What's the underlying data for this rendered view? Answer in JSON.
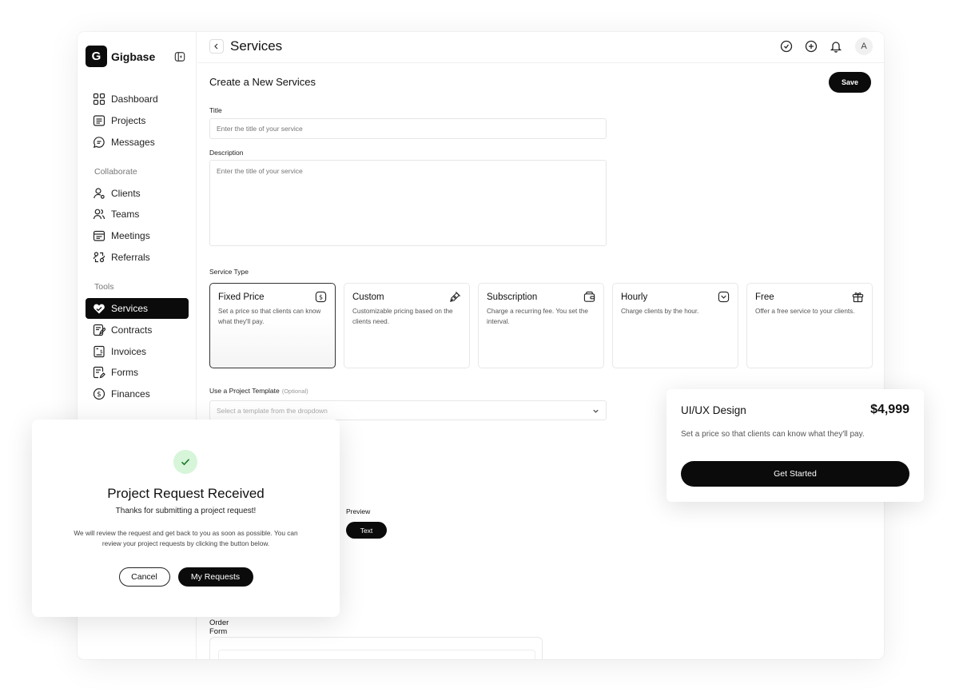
{
  "brand": {
    "logo_letter": "G",
    "name": "Gigbase"
  },
  "sidebar": {
    "main": [
      {
        "label": "Dashboard",
        "icon": "grid-icon"
      },
      {
        "label": "Projects",
        "icon": "list-icon"
      },
      {
        "label": "Messages",
        "icon": "chat-icon"
      }
    ],
    "collaborate_heading": "Collaborate",
    "collaborate": [
      {
        "label": "Clients",
        "icon": "user-icon"
      },
      {
        "label": "Teams",
        "icon": "users-icon"
      },
      {
        "label": "Meetings",
        "icon": "calendar-icon"
      },
      {
        "label": "Referrals",
        "icon": "referral-icon"
      }
    ],
    "tools_heading": "Tools",
    "tools": [
      {
        "label": "Services",
        "icon": "heart-hand-icon",
        "active": true
      },
      {
        "label": "Contracts",
        "icon": "contract-icon"
      },
      {
        "label": "Invoices",
        "icon": "invoice-icon"
      },
      {
        "label": "Forms",
        "icon": "form-icon"
      },
      {
        "label": "Finances",
        "icon": "dollar-icon"
      }
    ]
  },
  "header": {
    "title": "Services",
    "avatar": "A"
  },
  "form": {
    "heading": "Create a New Services",
    "save_label": "Save",
    "title_label": "Title",
    "title_placeholder": "Enter the title of your service",
    "description_label": "Description",
    "description_placeholder": "Enter the title of your service",
    "service_type_label": "Service Type",
    "service_types": [
      {
        "title": "Fixed Price",
        "desc": "Set a price so that clients can know what they'll pay.",
        "icon": "dollar-icon",
        "selected": true
      },
      {
        "title": "Custom",
        "desc": "Customizable pricing based on the clients need.",
        "icon": "pen-icon"
      },
      {
        "title": "Subscription",
        "desc": "Charge a recurring fee. You set the interval.",
        "icon": "wallet-icon"
      },
      {
        "title": "Hourly",
        "desc": "Charge clients by the hour.",
        "icon": "clock-icon"
      },
      {
        "title": "Free",
        "desc": "Offer a free service to your clients.",
        "icon": "gift-icon"
      }
    ],
    "template_label": "Use a Project Template",
    "template_optional": "(Optional)",
    "template_placeholder": "Select a template from the dropdown",
    "preview_label": "Preview",
    "preview_pill": "Text",
    "order_form_label": "Order Form"
  },
  "modal": {
    "title": "Project Request Received",
    "subtitle": "Thanks for submitting a project request!",
    "body": "We will review the request and get back to you as soon as possible. You can review your project requests by clicking the button below.",
    "cancel_label": "Cancel",
    "primary_label": "My Requests"
  },
  "pricing_card": {
    "title": "UI/UX Design",
    "price": "$4,999",
    "desc": "Set a price so that clients can know what they'll pay.",
    "button": "Get Started"
  },
  "colors": {
    "primary": "#0b0b0b",
    "success_bg": "#d6f5d9",
    "success": "#1e7a2e"
  }
}
